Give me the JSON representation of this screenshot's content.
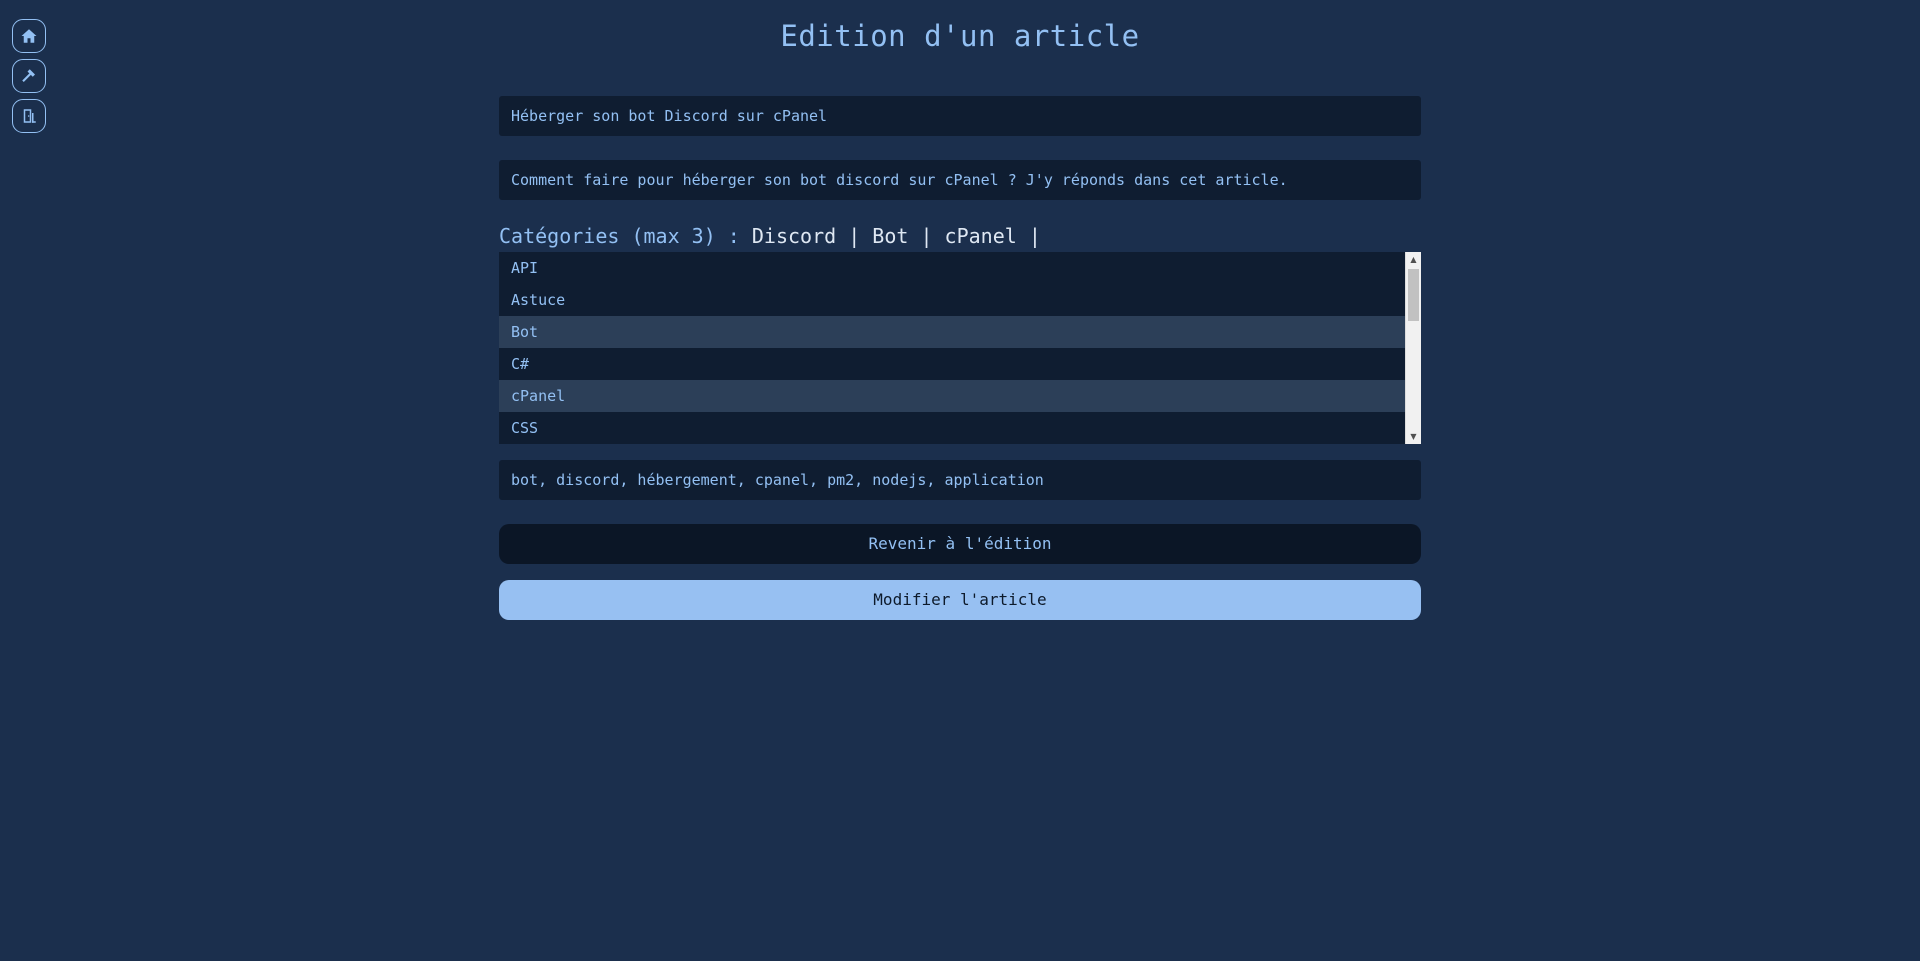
{
  "nav": {
    "items": [
      {
        "icon": "home-icon",
        "label": "Accueil"
      },
      {
        "icon": "hammer-icon",
        "label": "Outils"
      },
      {
        "icon": "logout-icon",
        "label": "Déconnexion"
      }
    ]
  },
  "page": {
    "title": "Edition d'un article"
  },
  "form": {
    "title_value": "Héberger son bot Discord sur cPanel",
    "description_value": "Comment faire pour héberger son bot discord sur cPanel ? J'y réponds dans cet article.",
    "categories_label": "Catégories (max 3) : ",
    "categories_selected": "Discord | Bot | cPanel |",
    "categories_options": [
      {
        "label": "API",
        "selected": false
      },
      {
        "label": "Astuce",
        "selected": false
      },
      {
        "label": "Bot",
        "selected": true
      },
      {
        "label": "C#",
        "selected": false
      },
      {
        "label": "cPanel",
        "selected": true
      },
      {
        "label": "CSS",
        "selected": false
      }
    ],
    "tags_value": "bot, discord, hébergement, cpanel, pm2, nodejs, application",
    "back_label": "Revenir à l'édition",
    "submit_label": "Modifier l'article"
  },
  "colors": {
    "background": "#1b2f4d",
    "field_background": "#0f1d31",
    "accent": "#93c0f3",
    "submit_background": "#97c0f2"
  }
}
